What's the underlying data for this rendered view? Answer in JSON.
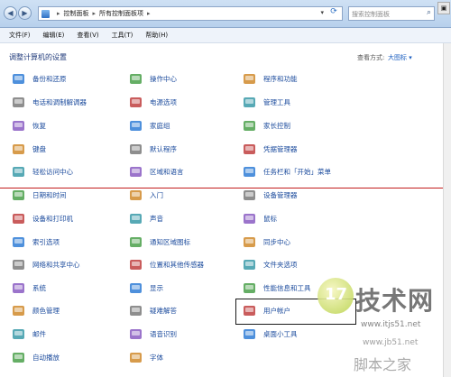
{
  "address_bar": {
    "breadcrumbs": [
      "控制面板",
      "所有控制面板项"
    ],
    "search_placeholder": "搜索控制面板"
  },
  "menu": {
    "items": [
      "文件(F)",
      "编辑(E)",
      "查看(V)",
      "工具(T)",
      "帮助(H)"
    ]
  },
  "main": {
    "title": "调整计算机的设置",
    "view_by_label": "查看方式:",
    "view_by_value": "大图标 ▾",
    "items": [
      {
        "label": "备份和还原",
        "icon": "backup-icon"
      },
      {
        "label": "操作中心",
        "icon": "action-center-flag-icon"
      },
      {
        "label": "程序和功能",
        "icon": "programs-icon"
      },
      {
        "label": "电话和调制解调器",
        "icon": "phone-modem-icon"
      },
      {
        "label": "电源选项",
        "icon": "power-options-icon"
      },
      {
        "label": "管理工具",
        "icon": "admin-tools-icon"
      },
      {
        "label": "恢复",
        "icon": "recovery-icon"
      },
      {
        "label": "家庭组",
        "icon": "homegroup-icon"
      },
      {
        "label": "家长控制",
        "icon": "parental-controls-icon"
      },
      {
        "label": "键盘",
        "icon": "keyboard-icon"
      },
      {
        "label": "默认程序",
        "icon": "default-programs-icon"
      },
      {
        "label": "凭据管理器",
        "icon": "credential-manager-icon"
      },
      {
        "label": "轻松访问中心",
        "icon": "ease-of-access-icon"
      },
      {
        "label": "区域和语言",
        "icon": "region-language-icon"
      },
      {
        "label": "任务栏和「开始」菜单",
        "icon": "taskbar-icon"
      },
      {
        "label": "日期和时间",
        "icon": "date-time-icon"
      },
      {
        "label": "入门",
        "icon": "getting-started-icon"
      },
      {
        "label": "设备管理器",
        "icon": "device-manager-icon"
      },
      {
        "label": "设备和打印机",
        "icon": "printer-icon"
      },
      {
        "label": "声音",
        "icon": "sound-icon"
      },
      {
        "label": "鼠标",
        "icon": "mouse-icon"
      },
      {
        "label": "索引选项",
        "icon": "indexing-icon"
      },
      {
        "label": "通知区域图标",
        "icon": "notification-area-icon"
      },
      {
        "label": "同步中心",
        "icon": "sync-center-icon"
      },
      {
        "label": "网络和共享中心",
        "icon": "network-icon"
      },
      {
        "label": "位置和其他传感器",
        "icon": "location-sensors-icon"
      },
      {
        "label": "文件夹选项",
        "icon": "folder-options-icon"
      },
      {
        "label": "系统",
        "icon": "system-icon"
      },
      {
        "label": "显示",
        "icon": "display-icon"
      },
      {
        "label": "性能信息和工具",
        "icon": "performance-icon"
      },
      {
        "label": "颜色管理",
        "icon": "color-management-icon"
      },
      {
        "label": "疑难解答",
        "icon": "troubleshooting-icon"
      },
      {
        "label": "用户帐户",
        "icon": "user-accounts-icon"
      },
      {
        "label": "邮件",
        "icon": "mail-icon"
      },
      {
        "label": "语音识别",
        "icon": "speech-recognition-icon"
      },
      {
        "label": "桌面小工具",
        "icon": "desktop-gadgets-icon"
      },
      {
        "label": "自动播放",
        "icon": "autoplay-icon"
      },
      {
        "label": "字体",
        "icon": "fonts-icon"
      }
    ]
  },
  "watermark": {
    "logo_number": "17",
    "brand": "技术网",
    "url_top": "www.itjs51.net",
    "url_bottom": "www.jb51.net",
    "footer": "脚本之家"
  }
}
